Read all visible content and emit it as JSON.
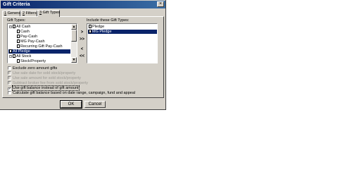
{
  "window": {
    "title": "Gift Criteria",
    "close_glyph": "×"
  },
  "tabs": [
    {
      "key": "1",
      "label": " General"
    },
    {
      "key": "2",
      "label": " Filters"
    },
    {
      "key": "3",
      "label": " Gift Types"
    }
  ],
  "gift_types": {
    "label": "Gift Types:",
    "items": [
      {
        "label": "All Cash",
        "expander": "−"
      },
      {
        "label": "Cash"
      },
      {
        "label": "Pay-Cash"
      },
      {
        "label": "MG Pay-Cash"
      },
      {
        "label": "Recurring Gift Pay-Cash"
      },
      {
        "label": "All Pledge"
      },
      {
        "label": "All Stock",
        "expander": "−"
      },
      {
        "label": "Stock/Property"
      }
    ],
    "selected": "All Pledge"
  },
  "include": {
    "label": "Include these Gift Types:",
    "items": [
      {
        "label": "Pledge"
      },
      {
        "label": "MG Pledge"
      }
    ],
    "selected": "MG Pledge"
  },
  "move_buttons": [
    ">",
    ">>",
    "<",
    "<<"
  ],
  "options": [
    {
      "label": "Exclude zero amount gifts",
      "checked": false,
      "enabled": true
    },
    {
      "label": "Use sale date for sold stock/property",
      "checked": false,
      "enabled": false
    },
    {
      "label": "Use sale amount for sold stock/property",
      "checked": false,
      "enabled": false
    },
    {
      "label": "Subtract broker fee from sold stock/property",
      "checked": false,
      "enabled": false
    },
    {
      "label": "Use gift balance instead of gift amount",
      "checked": true,
      "enabled": true
    },
    {
      "label": "Calculate gift balance based on date range, campaign, fund and appeal",
      "checked": false,
      "enabled": true
    }
  ],
  "buttons": {
    "ok": "OK",
    "cancel": "Cancel"
  },
  "scroll": {
    "up": "▲",
    "down": "▼"
  }
}
